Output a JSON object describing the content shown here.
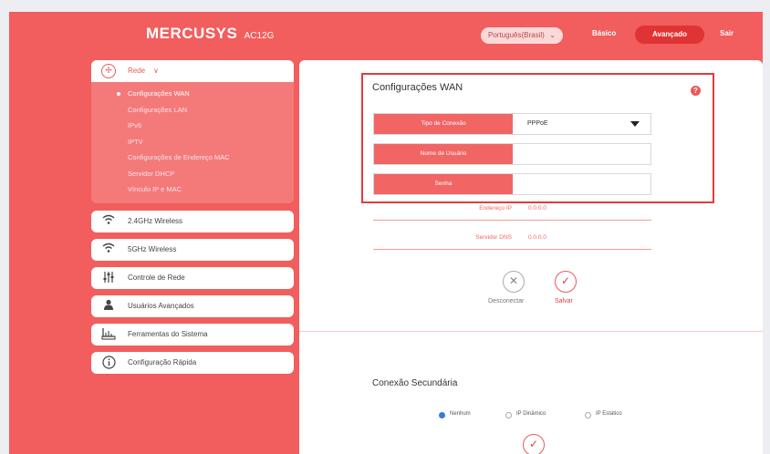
{
  "brand": {
    "name": "MERCUSYS",
    "model": "AC12G"
  },
  "header": {
    "language": "Português(Brasil)",
    "nav_basic": "Básico",
    "nav_advanced": "Avançado",
    "nav_exit": "Sair"
  },
  "sidebar": {
    "rede": {
      "label": "Rede",
      "items": [
        "Configurações WAN",
        "Configurações LAN",
        "IPv6",
        "IPTV",
        "Configurações de Endereço MAC",
        "Servidor DHCP",
        "Vínculo IP e MAC"
      ]
    },
    "groups": [
      {
        "label": "2.4GHz Wireless",
        "icon": "wifi-icon"
      },
      {
        "label": "5GHz Wireless",
        "icon": "wifi-icon"
      },
      {
        "label": "Controle de Rede",
        "icon": "sliders-icon"
      },
      {
        "label": "Usuários Avançados",
        "icon": "user-icon"
      },
      {
        "label": "Ferramentas do Sistema",
        "icon": "tools-icon"
      },
      {
        "label": "Configuração Rápida",
        "icon": "info-icon"
      }
    ]
  },
  "wan": {
    "title": "Configurações WAN",
    "connection_type_label": "Tipo de Conexão",
    "connection_type_value": "PPPoE",
    "username_label": "Nome de Usuário",
    "password_label": "Senha",
    "ip_label": "Endereço IP",
    "ip_value": "0.0.0.0",
    "dns_label": "Servidor DNS",
    "dns_value": "0.0.0.0",
    "disconnect_label": "Desconectar",
    "save_label": "Salvar"
  },
  "secondary": {
    "title": "Conexão Secundária",
    "options": [
      "Nenhum",
      "IP Dinâmico",
      "IP Estático"
    ],
    "selected": "Nenhum"
  },
  "colors": {
    "accent": "#f25d5d",
    "highlight_border": "#e23b3b",
    "radio_selected": "#3a78d8"
  }
}
